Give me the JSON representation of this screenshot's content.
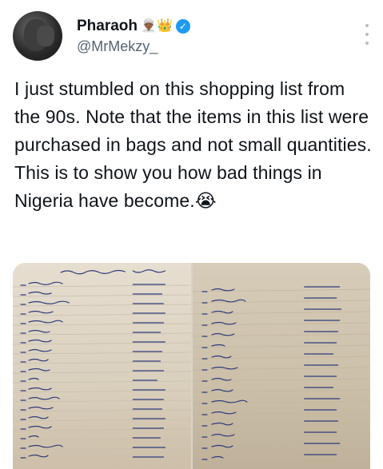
{
  "author": {
    "display_name": "Pharaoh",
    "name_emojis": "👳🏾‍♂️👑",
    "handle": "@MrMekzy_",
    "verified_icon": "✓"
  },
  "tweet": {
    "text": "I just stumbled on this shopping list from the 90s. Note that the items in this list were purchased in bags and not small quantities. This is to show you how bad things in Nigeria have become.",
    "emoji": "😭"
  },
  "colors": {
    "accent": "#1d9bf0",
    "handle": "#536471",
    "ink": "#2e3b7a",
    "paper": "#e6ded0"
  }
}
